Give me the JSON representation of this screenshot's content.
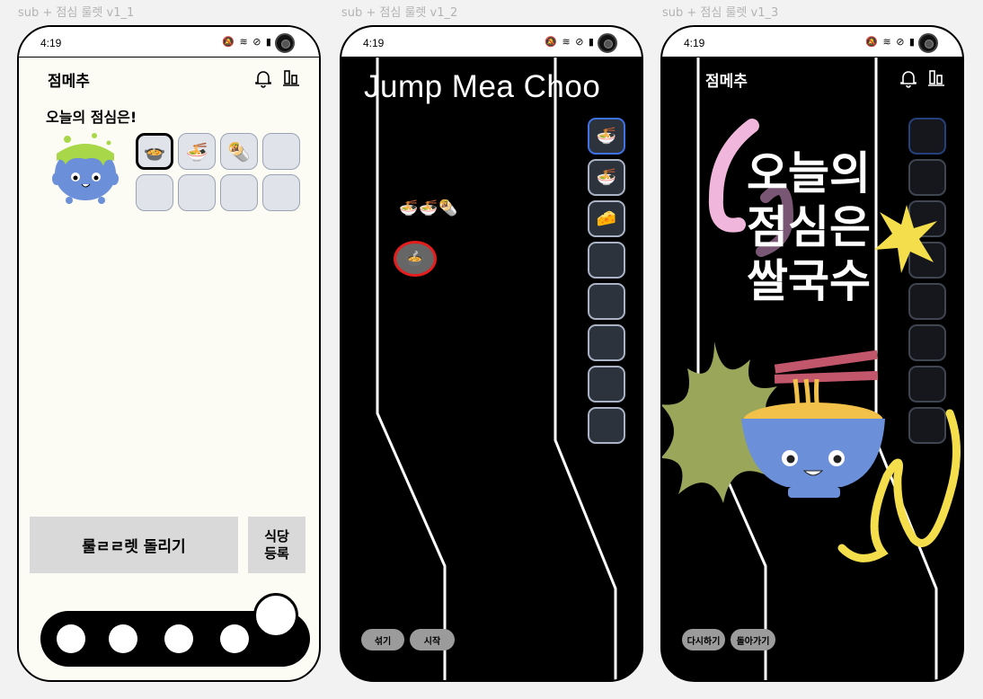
{
  "frames": [
    {
      "label": "sub + 점심 룰렛 v1_1"
    },
    {
      "label": "sub + 점심 룰렛 v1_2"
    },
    {
      "label": "sub + 점심 룰렛 v1_3"
    }
  ],
  "status": {
    "time": "4:19",
    "icons": "🔕 ≋ ⊘ ▮"
  },
  "screen1": {
    "app_title": "점메추",
    "heading": "오늘의 점심은!",
    "slots": [
      "🍲",
      "🍜",
      "🌯",
      "",
      "",
      "",
      "",
      ""
    ],
    "roulette_label": "룰ㄹㄹ렛 돌리기",
    "register_label": "식당\n등록",
    "icons": [
      "bell-icon",
      "stats-icon",
      "slime-pot-icon"
    ]
  },
  "screen2": {
    "title": "Jump Mea Choo",
    "column": [
      "🍜",
      "🍜",
      "🧀",
      "",
      "",
      "",
      "",
      ""
    ],
    "mini_foods": "🍜🍜🌯",
    "pick": "🍲",
    "shuffle_label": "섞기",
    "start_label": "시작"
  },
  "screen3": {
    "app_title": "점메추",
    "result_text": "오늘의\n점심은\n쌀국수",
    "retry_label": "다시하기",
    "back_label": "돌아가기",
    "colors": {
      "bowl": "#6b8fd8",
      "noodle": "#f2c14a",
      "star": "#f5de4b",
      "splat": "#9aa65a"
    }
  }
}
